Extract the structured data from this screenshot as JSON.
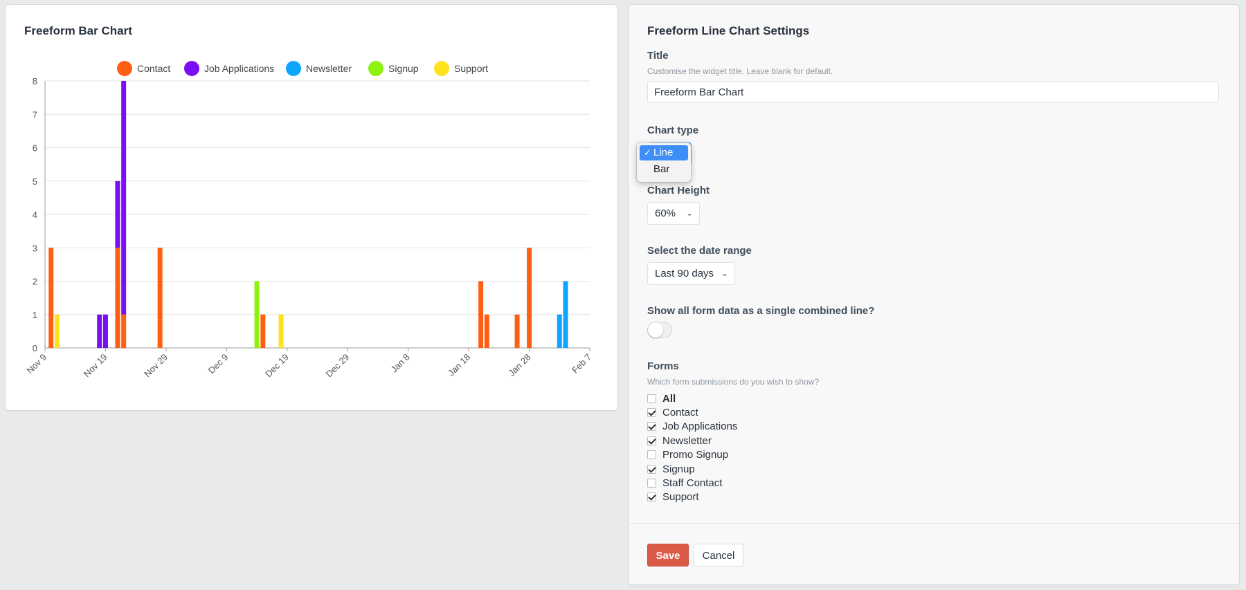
{
  "chart_card": {
    "title": "Freeform Bar Chart"
  },
  "chart_data": {
    "type": "bar",
    "stacked": true,
    "title": "Freeform Bar Chart",
    "x_tick_labels": [
      "Nov 9",
      "Nov 19",
      "Nov 29",
      "Dec 9",
      "Dec 19",
      "Dec 29",
      "Jan 8",
      "Jan 18",
      "Jan 28",
      "Feb 7"
    ],
    "y_ticks": [
      0,
      1,
      2,
      3,
      4,
      5,
      6,
      7,
      8
    ],
    "ylim": [
      0,
      8
    ],
    "grid": true,
    "legend_position": "top",
    "series": [
      {
        "name": "Contact",
        "color": "#ff5f12",
        "points": [
          {
            "date": "Nov 10",
            "value": 3
          },
          {
            "date": "Nov 21",
            "value": 3
          },
          {
            "date": "Nov 22",
            "value": 1
          },
          {
            "date": "Nov 28",
            "value": 3
          },
          {
            "date": "Dec 15",
            "value": 1
          },
          {
            "date": "Jan 20",
            "value": 2
          },
          {
            "date": "Jan 21",
            "value": 1
          },
          {
            "date": "Jan 26",
            "value": 1
          },
          {
            "date": "Jan 28",
            "value": 3
          }
        ]
      },
      {
        "name": "Job Applications",
        "color": "#7a0ff5",
        "points": [
          {
            "date": "Nov 18",
            "value": 1
          },
          {
            "date": "Nov 19",
            "value": 1
          },
          {
            "date": "Nov 21",
            "value": 2
          },
          {
            "date": "Nov 22",
            "value": 7
          }
        ]
      },
      {
        "name": "Newsletter",
        "color": "#0ea5ff",
        "points": [
          {
            "date": "Feb 2",
            "value": 1
          },
          {
            "date": "Feb 3",
            "value": 2
          }
        ]
      },
      {
        "name": "Signup",
        "color": "#8df20f",
        "points": [
          {
            "date": "Dec 14",
            "value": 2
          }
        ]
      },
      {
        "name": "Support",
        "color": "#ffe21f",
        "points": [
          {
            "date": "Nov 11",
            "value": 1
          },
          {
            "date": "Dec 18",
            "value": 1
          }
        ]
      }
    ]
  },
  "settings": {
    "heading": "Freeform Line Chart Settings",
    "title_field": {
      "label": "Title",
      "hint": "Customise the widget title. Leave blank for default.",
      "value": "Freeform Bar Chart"
    },
    "chart_type": {
      "label": "Chart type",
      "options": [
        "Line",
        "Bar"
      ],
      "selected": "Line",
      "check_glyph": "✓"
    },
    "chart_height": {
      "label": "Chart Height",
      "value": "60%"
    },
    "date_range": {
      "label": "Select the date range",
      "value": "Last 90 days"
    },
    "combined": {
      "label": "Show all form data as a single combined line?",
      "on": false
    },
    "forms": {
      "label": "Forms",
      "hint": "Which form submissions do you wish to show?",
      "items": [
        {
          "label": "All",
          "checked": false,
          "bold": true
        },
        {
          "label": "Contact",
          "checked": true
        },
        {
          "label": "Job Applications",
          "checked": true
        },
        {
          "label": "Newsletter",
          "checked": true
        },
        {
          "label": "Promo Signup",
          "checked": false
        },
        {
          "label": "Signup",
          "checked": true
        },
        {
          "label": "Staff Contact",
          "checked": false
        },
        {
          "label": "Support",
          "checked": true
        }
      ]
    },
    "save_label": "Save",
    "cancel_label": "Cancel",
    "chevron_glyph": "⌄"
  }
}
